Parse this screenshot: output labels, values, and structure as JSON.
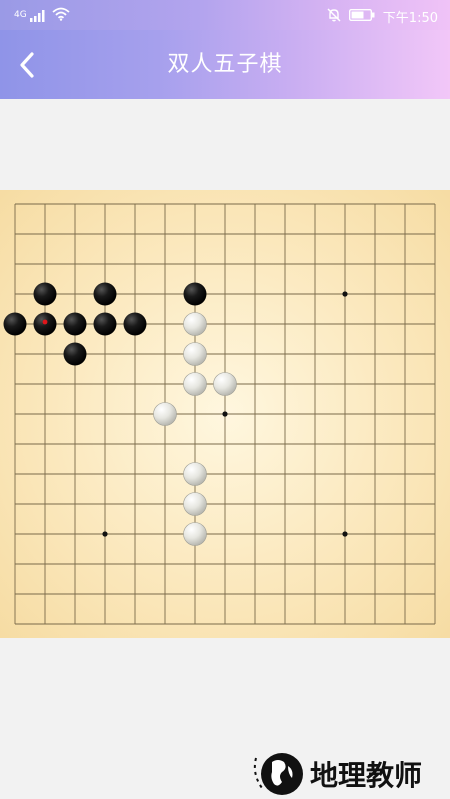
{
  "status_bar": {
    "network_label": "4G",
    "time": "下午1:50",
    "icons": [
      "signal-icon",
      "wifi-icon",
      "mute-icon",
      "battery-icon"
    ]
  },
  "header": {
    "back_icon": "chevron-left-icon",
    "title": "双人五子棋"
  },
  "board": {
    "size": 15,
    "star_points": [
      [
        3,
        3
      ],
      [
        11,
        3
      ],
      [
        7,
        7
      ],
      [
        3,
        11
      ],
      [
        11,
        11
      ]
    ],
    "last_move": [
      1,
      4
    ],
    "black_stones": [
      [
        1,
        3
      ],
      [
        3,
        3
      ],
      [
        6,
        3
      ],
      [
        0,
        4
      ],
      [
        1,
        4
      ],
      [
        2,
        4
      ],
      [
        3,
        4
      ],
      [
        4,
        4
      ],
      [
        2,
        5
      ]
    ],
    "white_stones": [
      [
        6,
        4
      ],
      [
        6,
        5
      ],
      [
        6,
        6
      ],
      [
        7,
        6
      ],
      [
        5,
        7
      ],
      [
        6,
        9
      ],
      [
        6,
        10
      ],
      [
        6,
        11
      ]
    ],
    "colors": {
      "line": "#7a6a4a",
      "black_stone": "#111111",
      "white_stone": "#d9d9d2",
      "last_move_marker": "#e0161b"
    }
  },
  "watermark": {
    "text": "地理教师",
    "logo_icon": "globe-logo-icon"
  }
}
